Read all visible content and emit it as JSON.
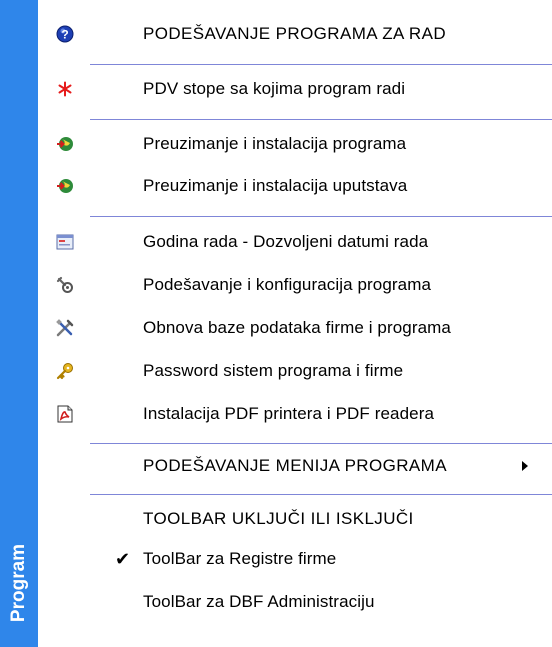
{
  "sidebar": {
    "title": "Program"
  },
  "menu": {
    "header": {
      "label": "PODEŠAVANJE PROGRAMA ZA RAD",
      "icon": "help-icon"
    },
    "pdv": {
      "label": "PDV stope sa kojima program radi",
      "icon": "asterisk-icon"
    },
    "download_program": {
      "label": "Preuzimanje i instalacija programa",
      "icon": "download-icon"
    },
    "download_manuals": {
      "label": "Preuzimanje i instalacija uputstava",
      "icon": "download-icon"
    },
    "year": {
      "label": "Godina rada - Dozvoljeni datumi rada",
      "icon": "calendar-window-icon"
    },
    "config": {
      "label": "Podešavanje i konfiguracija programa",
      "icon": "wrench-gear-icon"
    },
    "restore": {
      "label": "Obnova baze podataka firme i programa",
      "icon": "tools-icon"
    },
    "password": {
      "label": "Password sistem programa i firme",
      "icon": "key-icon"
    },
    "pdf": {
      "label": "Instalacija PDF printera i PDF readera",
      "icon": "pdf-icon"
    },
    "menu_settings": {
      "label": "PODEŠAVANJE MENIJA PROGRAMA",
      "icon": "submenu-arrow-icon"
    },
    "toolbar_section": {
      "label": "TOOLBAR UKLJUČI ILI ISKLJUČI"
    },
    "toolbar_registers": {
      "label": "ToolBar za Registre firme",
      "checked": true
    },
    "toolbar_dbf": {
      "label": "ToolBar za DBF Administraciju",
      "checked": false
    }
  },
  "colors": {
    "sidebar": "#2f86ea",
    "separator": "#7f86d8"
  }
}
